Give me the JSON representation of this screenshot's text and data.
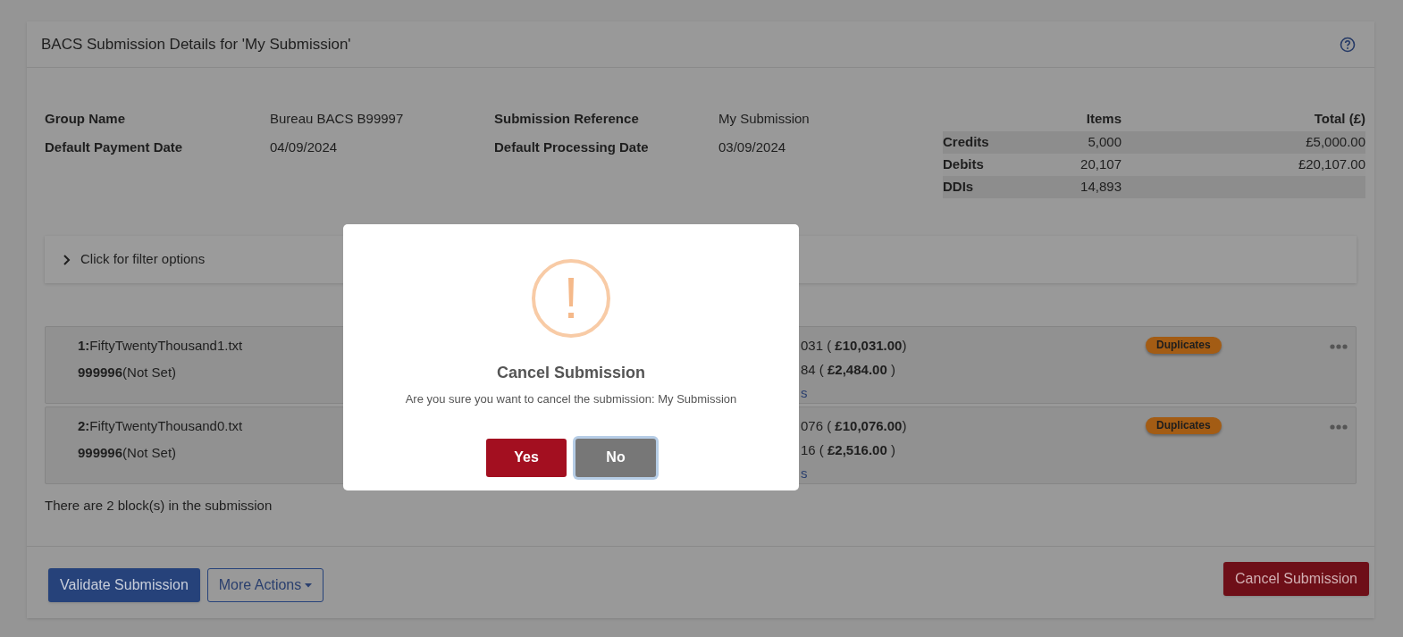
{
  "panel": {
    "title": "BACS Submission Details for 'My Submission'"
  },
  "details": [
    {
      "label": "Group Name",
      "value": "Bureau BACS B99997"
    },
    {
      "label": "Default Payment Date",
      "value": "04/09/2024"
    },
    {
      "label": "Submission Reference",
      "value": "My Submission"
    },
    {
      "label": "Default Processing Date",
      "value": "03/09/2024"
    }
  ],
  "totals": {
    "columns": [
      "Items",
      "Total (£)"
    ],
    "rows": [
      {
        "label": "Credits",
        "items": "5,000",
        "total": "£5,000.00"
      },
      {
        "label": "Debits",
        "items": "20,107",
        "total": "£20,107.00"
      },
      {
        "label": "DDIs",
        "items": "14,893"
      }
    ]
  },
  "filter": {
    "label": "Click for filter options",
    "expanded": false
  },
  "blocks": [
    {
      "number": "1:",
      "filename": "FiftyTwentyThousand1.txt",
      "sun": "999996",
      "sun_name": "(Not Set)",
      "line_1": "031 ( **£10,031.00**)",
      "line_2": "84 ( **£2,484.00** )",
      "line_3": "s",
      "badge": "Duplicates"
    },
    {
      "number": "2:",
      "filename": "FiftyTwentyThousand0.txt",
      "sun": "999996",
      "sun_name": "(Not Set)",
      "line_1": "076 ( **£10,076.00**)",
      "line_2": "16 ( **£2,516.00** )",
      "line_3": "s",
      "badge": "Duplicates"
    }
  ],
  "summary": "There are 2 block(s) in the submission",
  "actions": {
    "validate": "Validate Submission",
    "more": "More Actions",
    "cancel": "Cancel Submission"
  },
  "dialog": {
    "title": "Cancel Submission",
    "message": "Are you sure you want to cancel the submission: My Submission",
    "buttons": [
      {
        "label": "Yes",
        "kind": "danger",
        "focused": false
      },
      {
        "label": "No",
        "kind": "secondary",
        "focused": true
      }
    ]
  }
}
